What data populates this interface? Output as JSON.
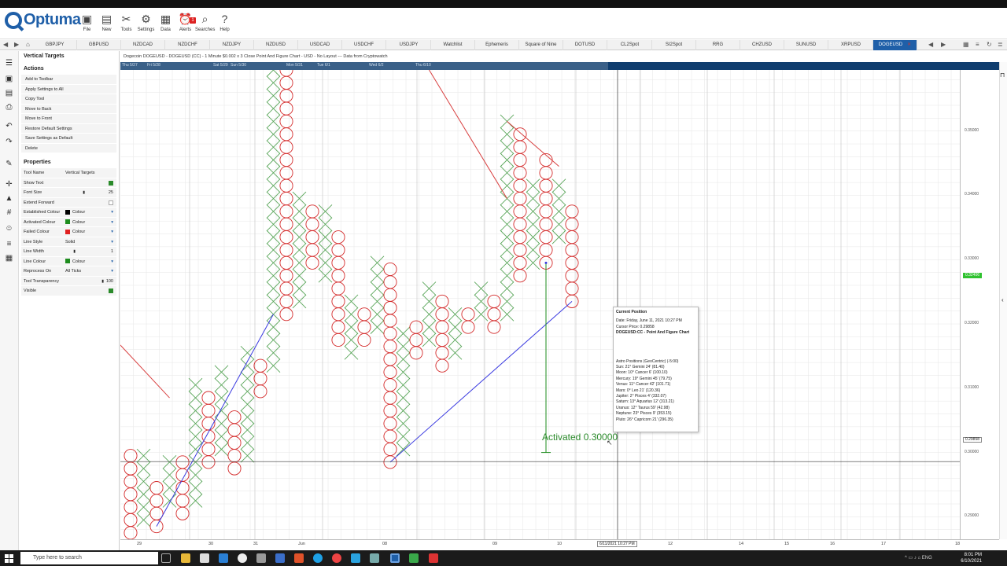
{
  "ribbon": {
    "logo_text": "Optuma",
    "buttons": [
      {
        "label": "File",
        "icon": "folder-icon",
        "glyph": "▣"
      },
      {
        "label": "New",
        "icon": "new-page-icon",
        "glyph": "▤"
      },
      {
        "label": "Tools",
        "icon": "tools-icon",
        "glyph": "✂"
      },
      {
        "label": "Settings",
        "icon": "gear-icon",
        "glyph": "⚙"
      },
      {
        "label": "Data",
        "icon": "data-grid-icon",
        "glyph": "▦"
      },
      {
        "label": "Alerts",
        "icon": "alarm-clock-icon",
        "glyph": "⏰"
      },
      {
        "label": "Searches",
        "icon": "magnifier-icon",
        "glyph": "⌕"
      },
      {
        "label": "Help",
        "icon": "help-icon",
        "glyph": "?"
      }
    ],
    "alert_badge": "1"
  },
  "tabs": [
    "GBPJPY",
    "GBPUSD",
    "NZDCAD",
    "NZDCHF",
    "NZDJPY",
    "NZDUSD",
    "USDCAD",
    "USDCHF",
    "USDJPY",
    "Watchlist",
    "Ephemeris",
    "Square of Nine",
    "DOTUSD",
    "CL2Spot",
    "SI2Spot",
    "RRG",
    "CHZUSD",
    "SUNUSD",
    "XRPUSD",
    "DOGEUSD"
  ],
  "active_tab": "DOGEUSD",
  "panel": {
    "title": "Vertical Targets",
    "actions_heading": "Actions",
    "actions": [
      "Add to Toolbar",
      "Apply Settings to All",
      "Copy Tool",
      "Move to Back",
      "Move to Front",
      "Restore Default Settings",
      "Save Settings as Default",
      "Delete"
    ],
    "properties_heading": "Properties",
    "properties": [
      {
        "name": "Tool Name",
        "value": "Vertical Targets"
      },
      {
        "name": "Show Text",
        "check": true
      },
      {
        "name": "Font Size",
        "value": "25"
      },
      {
        "name": "Extend Forward",
        "check": false
      },
      {
        "name": "Established Colour",
        "value": "Colour",
        "swatch": "#000000",
        "dropdown": true
      },
      {
        "name": "Activated Colour",
        "value": "Colour",
        "swatch": "#1e8c1e",
        "dropdown": true
      },
      {
        "name": "Failed Colour",
        "value": "Colour",
        "swatch": "#e02020",
        "dropdown": true
      },
      {
        "name": "Line Style",
        "value": "Solid",
        "dropdown": true
      },
      {
        "name": "Line Width",
        "value": "1"
      },
      {
        "name": "Line Colour",
        "value": "Colour",
        "swatch": "#1e8c1e",
        "dropdown": true
      },
      {
        "name": "Reprocess On",
        "value": "All Ticks",
        "dropdown": true
      },
      {
        "name": "Tool Transparency",
        "value": "100"
      },
      {
        "name": "Visible",
        "check": true
      }
    ]
  },
  "chart_header": "Dogecoin DOGEUSD - DOGEUSD (CC) - 1 Minute $0.002 x 3 Close Point And Figure Chart - USD - No Layout --- Data from Cryptowatch",
  "timeline_labels": [
    "Thu 5/27",
    "Fri 5/28",
    "Sat 5/29",
    "Sun 5/30",
    "Mon 5/31",
    "Tue 6/1",
    "Wed 6/2",
    "Thu 6/10"
  ],
  "y_axis_labels": [
    "0.35000",
    "0.34000",
    "0.33000",
    "0.32000",
    "0.31000",
    "0.30000",
    "0.29000"
  ],
  "last_price": "0.32406",
  "cursor_price_tag": "0.29858",
  "x_axis_labels": [
    "29",
    "30",
    "31",
    "Jun",
    "08",
    "09",
    "10",
    "12",
    "14",
    "15",
    "16",
    "17",
    "18"
  ],
  "x_cursor_label": "6/11/2021 10:27 PM",
  "activated_text": "Activated 0.30000",
  "tooltip": {
    "title": "Current Position",
    "date": "Date: Friday, June 11, 2021 10:27 PM",
    "cursor_price": "Cursor Price: 0.29858",
    "series": "DOGEUSD:CC - Point And Figure Chart",
    "astro_heading": "Astro Positions (GeoCentric) (-5:00)",
    "astro": [
      "Sun: 21° Gemini 24' (81.40)",
      "Moon: 10° Cancer 6' (100.10)",
      "Mercury: 19° Gemini 45' (79.75)",
      "Venus: 11° Cancer 42' (101.71)",
      "Mars: 0° Leo 21' (120.36)",
      "Jupiter: 2° Pisces 4' (332.07)",
      "Saturn: 13° Aquarius 12' (313.21)",
      "Uranus: 12° Taurus 59' (42.98)",
      "Neptune: 23° Pisces 9' (353.15)",
      "Pluto: 26° Capricorn 21' (296.35)"
    ]
  },
  "colors": {
    "x_mark": "#5aa65a",
    "o_mark": "#d42a2a",
    "support": "#3a3ae0",
    "resistance": "#d84040",
    "target": "#1e8c1e",
    "brand": "#1f5fa8"
  },
  "chart_data": {
    "type": "point-and-figure",
    "box_size": 0.002,
    "reversal": 3,
    "ylim": [
      0.2865,
      0.3595
    ],
    "columns": [
      {
        "type": "O",
        "high": 0.2985,
        "low": 0.2875
      },
      {
        "type": "X",
        "high": 0.2985,
        "low": 0.2895
      },
      {
        "type": "O",
        "high": 0.2945,
        "low": 0.2885
      },
      {
        "type": "X",
        "high": 0.2985,
        "low": 0.2925
      },
      {
        "type": "O",
        "high": 0.2985,
        "low": 0.2905
      },
      {
        "type": "X",
        "high": 0.3095,
        "low": 0.2925
      },
      {
        "type": "O",
        "high": 0.3075,
        "low": 0.2985
      },
      {
        "type": "X",
        "high": 0.3115,
        "low": 0.3005
      },
      {
        "type": "O",
        "high": 0.3055,
        "low": 0.2975
      },
      {
        "type": "X",
        "high": 0.3155,
        "low": 0.2995
      },
      {
        "type": "O",
        "high": 0.3135,
        "low": 0.3095
      },
      {
        "type": "X",
        "high": 0.3595,
        "low": 0.3135
      },
      {
        "type": "O",
        "high": 0.3595,
        "low": 0.3215
      },
      {
        "type": "X",
        "high": 0.3395,
        "low": 0.3235
      },
      {
        "type": "O",
        "high": 0.3375,
        "low": 0.3295
      },
      {
        "type": "X",
        "high": 0.3375,
        "low": 0.3275
      },
      {
        "type": "O",
        "high": 0.3335,
        "low": 0.3175
      },
      {
        "type": "X",
        "high": 0.3235,
        "low": 0.3155
      },
      {
        "type": "O",
        "high": 0.3215,
        "low": 0.3175
      },
      {
        "type": "X",
        "high": 0.3295,
        "low": 0.3195
      },
      {
        "type": "O",
        "high": 0.3275,
        "low": 0.2985
      },
      {
        "type": "X",
        "high": 0.3175,
        "low": 0.3005
      },
      {
        "type": "O",
        "high": 0.3195,
        "low": 0.3155
      },
      {
        "type": "X",
        "high": 0.3255,
        "low": 0.3175
      },
      {
        "type": "O",
        "high": 0.3235,
        "low": 0.3135
      },
      {
        "type": "X",
        "high": 0.3215,
        "low": 0.3155
      },
      {
        "type": "O",
        "high": 0.3215,
        "low": 0.3195
      },
      {
        "type": "X",
        "high": 0.3255,
        "low": 0.3215
      },
      {
        "type": "O",
        "high": 0.3235,
        "low": 0.3195
      },
      {
        "type": "X",
        "high": 0.3515,
        "low": 0.3215
      },
      {
        "type": "O",
        "high": 0.3495,
        "low": 0.3275
      },
      {
        "type": "X",
        "high": 0.3415,
        "low": 0.3295
      },
      {
        "type": "O",
        "high": 0.3455,
        "low": 0.3295
      },
      {
        "type": "X",
        "high": 0.3415,
        "low": 0.3335
      },
      {
        "type": "O",
        "high": 0.3375,
        "low": 0.3235
      }
    ],
    "trendlines": [
      {
        "kind": "support",
        "from": {
          "col": 2,
          "y": 0.2885
        },
        "to": {
          "col": 11,
          "y": 0.3215
        }
      },
      {
        "kind": "support",
        "from": {
          "col": 20,
          "y": 0.2985
        },
        "to": {
          "col": 34,
          "y": 0.3235
        }
      },
      {
        "kind": "resistance",
        "from": {
          "col": -3,
          "y": 0.3215
        },
        "to": {
          "col": 3,
          "y": 0.3085
        }
      },
      {
        "kind": "resistance",
        "from": {
          "col": 23,
          "y": 0.3595
        },
        "to": {
          "col": 29,
          "y": 0.3395
        }
      },
      {
        "kind": "resistance",
        "from": {
          "col": 29,
          "y": 0.3515
        },
        "to": {
          "col": 33,
          "y": 0.3445
        }
      }
    ],
    "vertical_target": {
      "col": 32,
      "from": 0.3295,
      "to": 0.3,
      "label": "Activated 0.30000"
    },
    "cursor": {
      "price": 0.29858
    }
  }
}
